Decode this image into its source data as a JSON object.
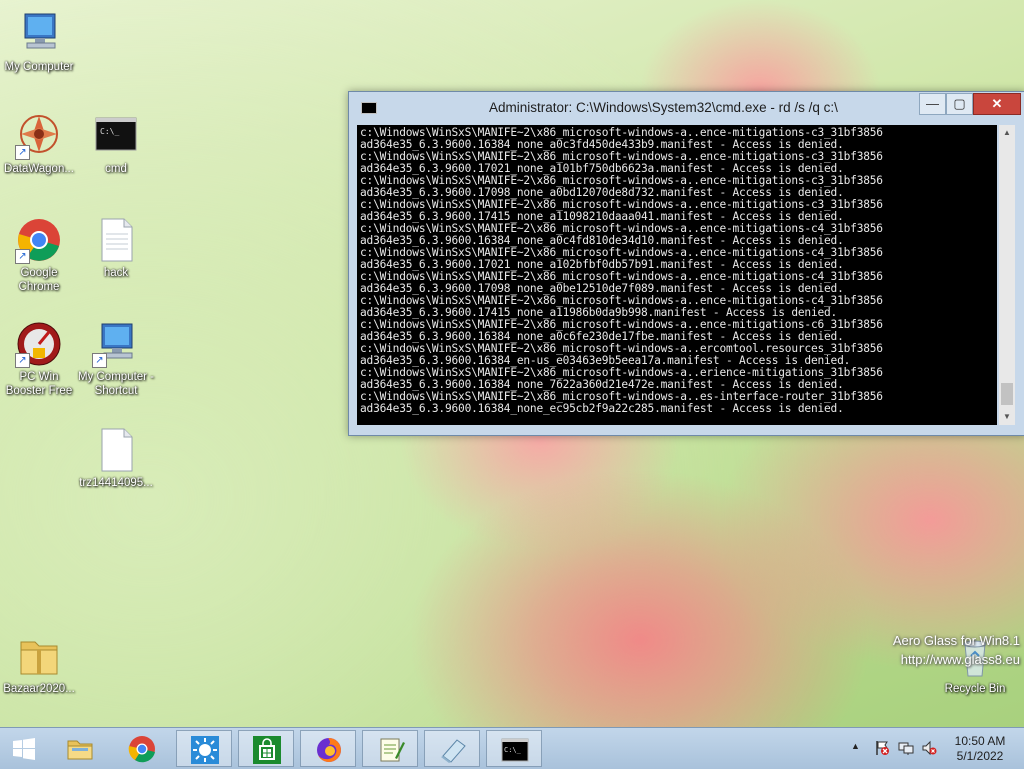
{
  "desktop": {
    "icons": [
      {
        "label": "My Computer"
      },
      {
        "label": "DataWagon..."
      },
      {
        "label": "cmd"
      },
      {
        "label": "Google Chrome"
      },
      {
        "label": "hack"
      },
      {
        "label": "PC Win Booster Free"
      },
      {
        "label": "My Computer - Shortcut"
      },
      {
        "label": "trz14414095..."
      },
      {
        "label": "Bazaar2020..."
      },
      {
        "label": "Recycle Bin"
      }
    ]
  },
  "cmd_window": {
    "title": "Administrator: C:\\Windows\\System32\\cmd.exe - rd  /s /q c:\\",
    "minimize_glyph": "—",
    "maximize_glyph": "▢",
    "close_glyph": "✕",
    "lines": [
      "c:\\Windows\\WinSxS\\MANIFE~2\\x86_microsoft-windows-a..ence-mitigations-c3_31bf3856",
      "ad364e35_6.3.9600.16384_none_a0c3fd450de433b9.manifest - Access is denied.",
      "c:\\Windows\\WinSxS\\MANIFE~2\\x86_microsoft-windows-a..ence-mitigations-c3_31bf3856",
      "ad364e35_6.3.9600.17021_none_a101bf750db6623a.manifest - Access is denied.",
      "c:\\Windows\\WinSxS\\MANIFE~2\\x86_microsoft-windows-a..ence-mitigations-c3_31bf3856",
      "ad364e35_6.3.9600.17098_none_a0bd12070de8d732.manifest - Access is denied.",
      "c:\\Windows\\WinSxS\\MANIFE~2\\x86_microsoft-windows-a..ence-mitigations-c3_31bf3856",
      "ad364e35_6.3.9600.17415_none_a11098210daaa041.manifest - Access is denied.",
      "c:\\Windows\\WinSxS\\MANIFE~2\\x86_microsoft-windows-a..ence-mitigations-c4_31bf3856",
      "ad364e35_6.3.9600.16384_none_a0c4fd810de34d10.manifest - Access is denied.",
      "c:\\Windows\\WinSxS\\MANIFE~2\\x86_microsoft-windows-a..ence-mitigations-c4_31bf3856",
      "ad364e35_6.3.9600.17021_none_a102bfbf0db57b91.manifest - Access is denied.",
      "c:\\Windows\\WinSxS\\MANIFE~2\\x86_microsoft-windows-a..ence-mitigations-c4_31bf3856",
      "ad364e35_6.3.9600.17098_none_a0be12510de7f089.manifest - Access is denied.",
      "c:\\Windows\\WinSxS\\MANIFE~2\\x86_microsoft-windows-a..ence-mitigations-c4_31bf3856",
      "ad364e35_6.3.9600.17415_none_a11986b0da9b998.manifest - Access is denied.",
      "c:\\Windows\\WinSxS\\MANIFE~2\\x86_microsoft-windows-a..ence-mitigations-c6_31bf3856",
      "ad364e35_6.3.9600.16384_none_a0c6fe230de17fbe.manifest - Access is denied.",
      "c:\\Windows\\WinSxS\\MANIFE~2\\x86_microsoft-windows-a..ercomtool.resources_31bf3856",
      "ad364e35_6.3.9600.16384_en-us_e03463e9b5eea17a.manifest - Access is denied.",
      "c:\\Windows\\WinSxS\\MANIFE~2\\x86_microsoft-windows-a..erience-mitigations_31bf3856",
      "ad364e35_6.3.9600.16384_none_7622a360d21e472e.manifest - Access is denied.",
      "c:\\Windows\\WinSxS\\MANIFE~2\\x86_microsoft-windows-a..es-interface-router_31bf3856",
      "ad364e35_6.3.9600.16384_none_ec95cb2f9a22c285.manifest - Access is denied."
    ]
  },
  "watermark": {
    "line1": "Aero Glass for Win8.1",
    "line2": "http://www.glass8.eu"
  },
  "taskbar": {
    "clock_time": "10:50 AM",
    "clock_date": "5/1/2022",
    "tray_arrow": "▲",
    "colors": {
      "start": "#ffffff",
      "store": "#1b8a2e",
      "cmd_bg": "#000000"
    }
  }
}
